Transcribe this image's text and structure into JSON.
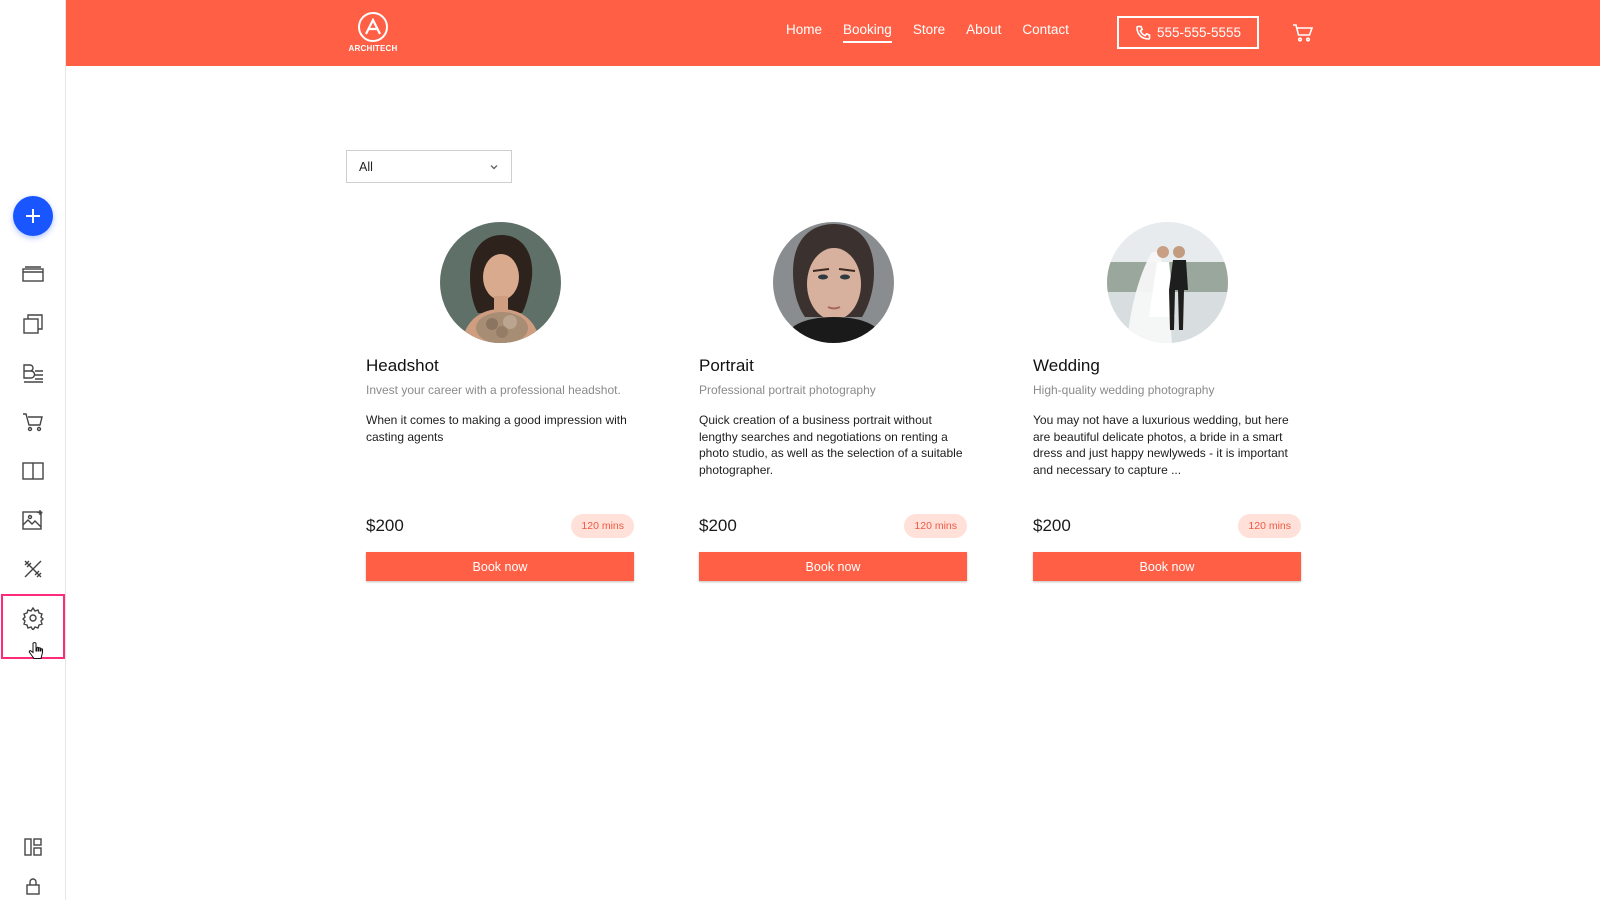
{
  "brand": {
    "logo_text": "ARCHITECH",
    "color": "#ff5f45"
  },
  "nav": [
    {
      "label": "Home",
      "active": false
    },
    {
      "label": "Booking",
      "active": true
    },
    {
      "label": "Store",
      "active": false
    },
    {
      "label": "About",
      "active": false
    },
    {
      "label": "Contact",
      "active": false
    }
  ],
  "phone": {
    "label": "555-555-5555",
    "icon": "phone-icon"
  },
  "cart": {
    "icon": "cart-icon"
  },
  "filter": {
    "selected": "All",
    "icon": "chevron-down-icon"
  },
  "services": [
    {
      "title": "Headshot",
      "subtitle": "Invest your career with a professional headshot.",
      "description": "When it comes to making a good impression with casting agents",
      "price": "$200",
      "duration": "120 mins",
      "button": "Book now"
    },
    {
      "title": "Portrait",
      "subtitle": "Professional portrait photography",
      "description": "Quick creation of a business portrait without lengthy searches and negotiations on renting a photo studio, as well as the selection of a suitable photographer.",
      "price": "$200",
      "duration": "120 mins",
      "button": "Book now"
    },
    {
      "title": "Wedding",
      "subtitle": "High-quality wedding photography",
      "description": "You may not have a luxurious wedding, but here are beautiful delicate photos, a bride in a smart dress and just happy newlyweds - it is important and necessary to capture ...",
      "price": "$200",
      "duration": "120 mins",
      "button": "Book now"
    }
  ],
  "rail": {
    "add_icon": "plus-icon",
    "items": [
      "layout-icon",
      "pages-icon",
      "blog-icon",
      "store-cart-icon",
      "book-icon",
      "media-icon",
      "design-tools-icon",
      "settings-gear-icon"
    ],
    "highlighted": "settings-gear-icon",
    "bottom": [
      "dashboard-icon",
      "lock-icon"
    ],
    "accent": "#1a56ff",
    "highlight_color": "#ff2a7a"
  }
}
